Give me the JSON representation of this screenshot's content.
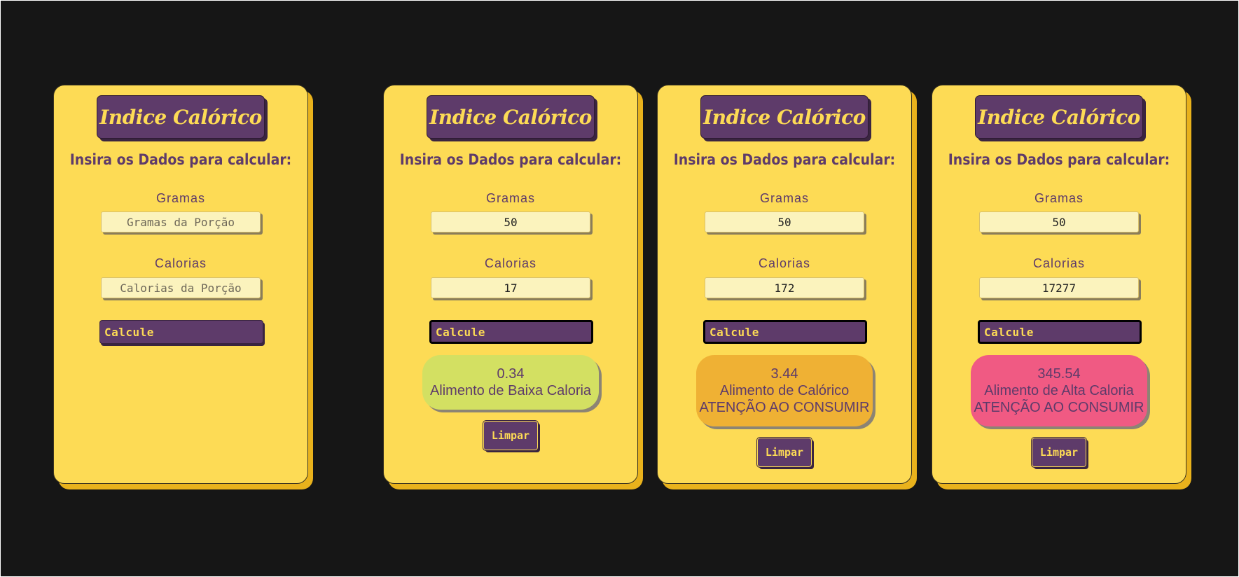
{
  "colors": {
    "background": "#161616",
    "card": "#fddb55",
    "accent": "#5e3b6a",
    "field": "#fbf3bd",
    "result_low": "#d3e062",
    "result_mid": "#efb134",
    "result_high": "#f05a83"
  },
  "cards": [
    {
      "title": "Indice Calórico",
      "subtitle": "Insira os Dados para calcular:",
      "gramas_label": "Gramas",
      "gramas_placeholder": "Gramas da Porção",
      "gramas_value": "",
      "calorias_label": "Calorias",
      "calorias_placeholder": "Calorias da Porção",
      "calorias_value": "",
      "calc_label": "Calcule"
    },
    {
      "title": "Indice Calórico",
      "subtitle": "Insira os Dados para calcular:",
      "gramas_label": "Gramas",
      "gramas_placeholder": "Gramas da Porção",
      "gramas_value": "50",
      "calorias_label": "Calorias",
      "calorias_placeholder": "Calorias da Porção",
      "calorias_value": "17",
      "calc_label": "Calcule",
      "result_value": "0.34",
      "result_line1": "Alimento de Baixa Caloria",
      "result_line2": "",
      "clear_label": "Limpar"
    },
    {
      "title": "Indice Calórico",
      "subtitle": "Insira os Dados para calcular:",
      "gramas_label": "Gramas",
      "gramas_placeholder": "Gramas da Porção",
      "gramas_value": "50",
      "calorias_label": "Calorias",
      "calorias_placeholder": "Calorias da Porção",
      "calorias_value": "172",
      "calc_label": "Calcule",
      "result_value": "3.44",
      "result_line1": "Alimento de Calórico",
      "result_line2": "ATENÇÃO AO CONSUMIR",
      "clear_label": "Limpar"
    },
    {
      "title": "Indice Calórico",
      "subtitle": "Insira os Dados para calcular:",
      "gramas_label": "Gramas",
      "gramas_placeholder": "Gramas da Porção",
      "gramas_value": "50",
      "calorias_label": "Calorias",
      "calorias_placeholder": "Calorias da Porção",
      "calorias_value": "17277",
      "calc_label": "Calcule",
      "result_value": "345.54",
      "result_line1": "Alimento de Alta Caloria",
      "result_line2": "ATENÇÃO AO CONSUMIR",
      "clear_label": "Limpar"
    }
  ]
}
